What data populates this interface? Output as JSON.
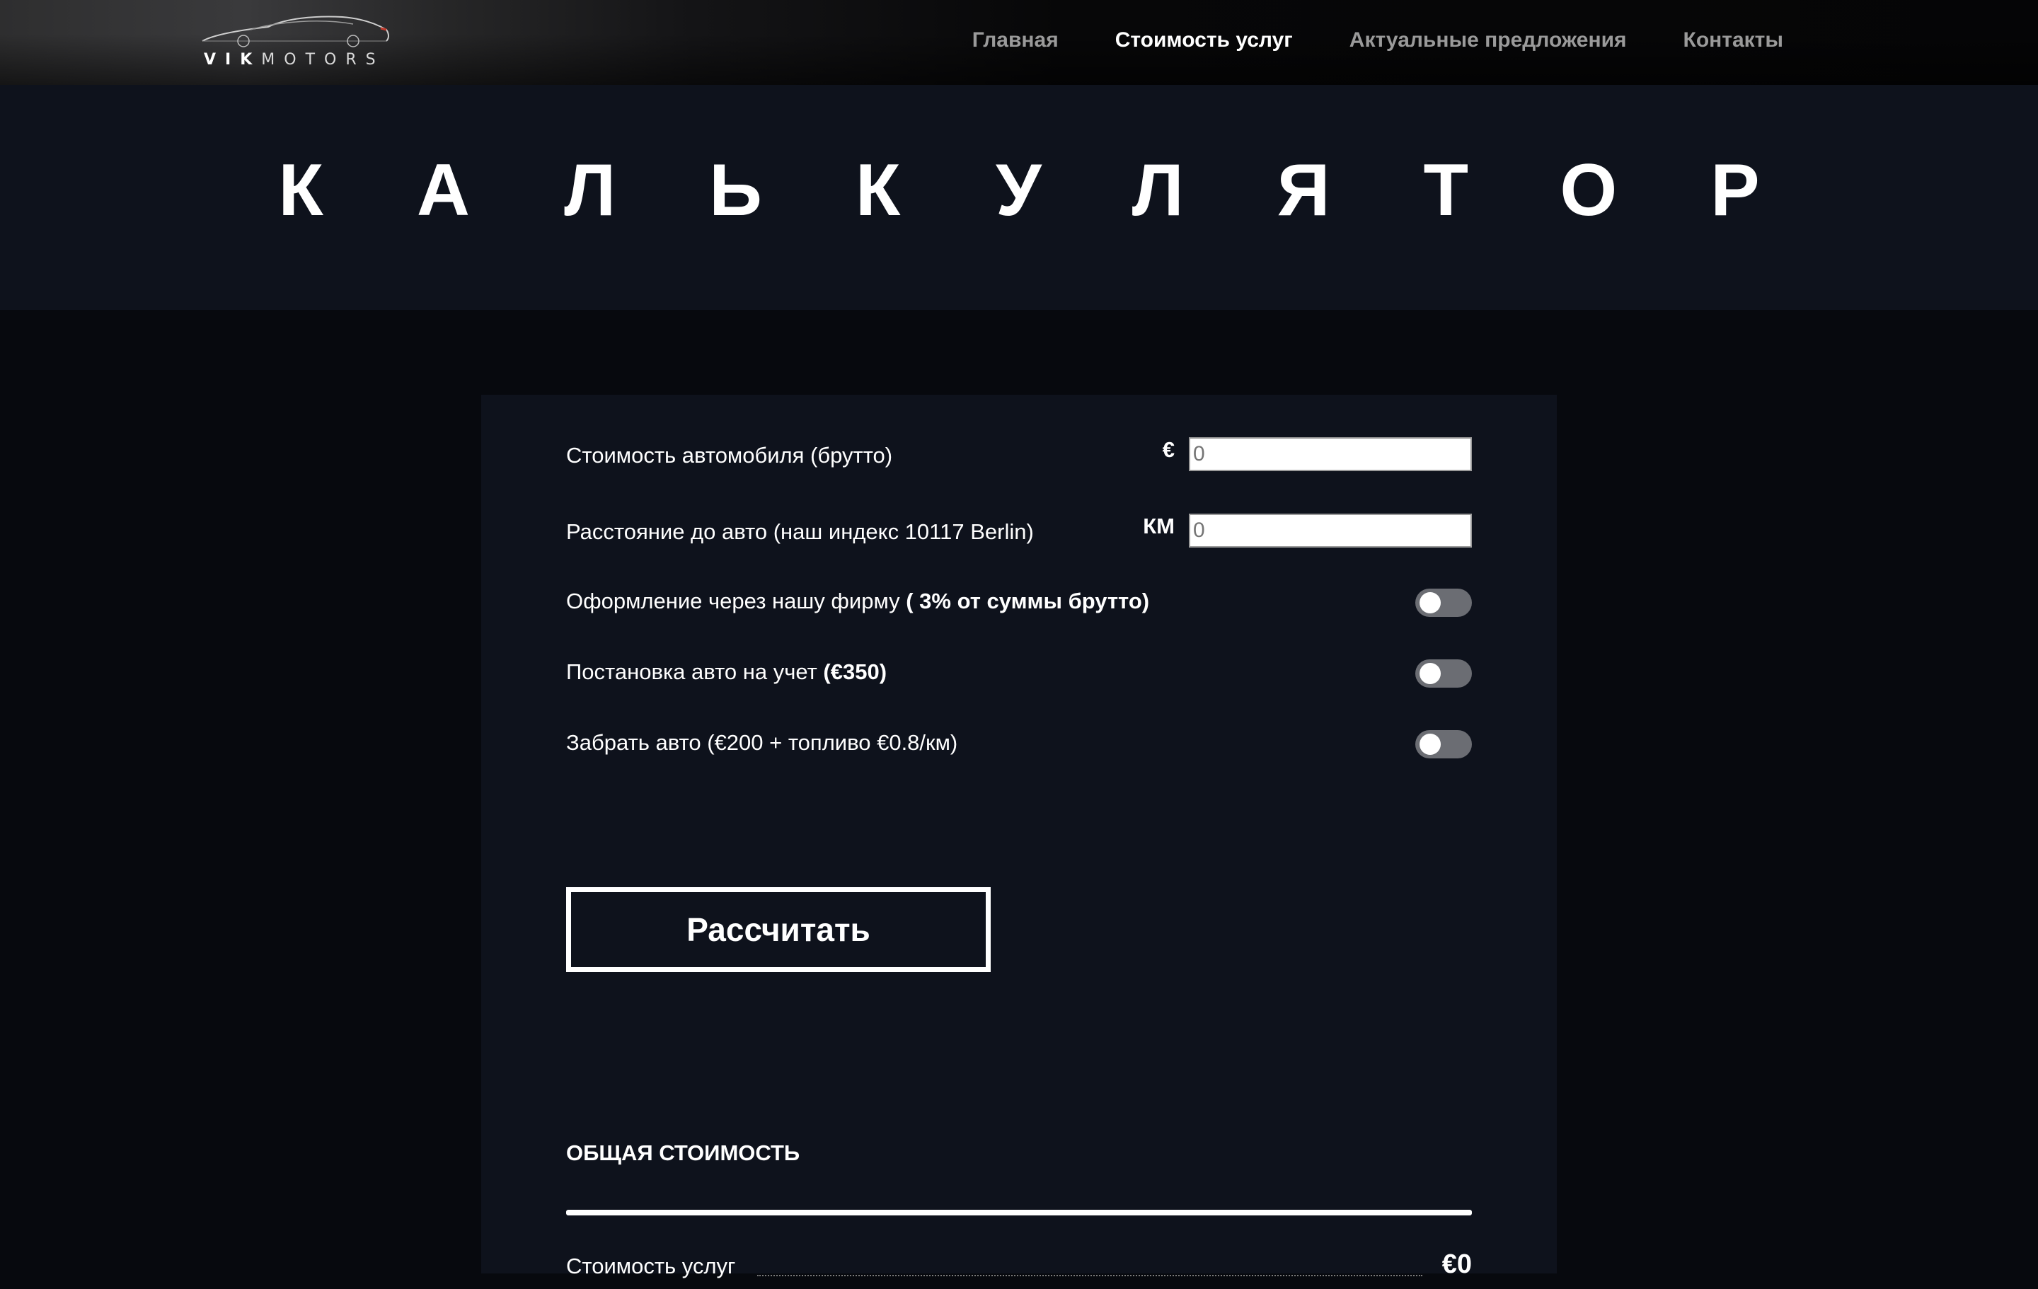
{
  "header": {
    "logo": {
      "brand_bold": "VIK",
      "brand_thin": "MOTORS"
    },
    "nav": [
      {
        "label": "Главная",
        "active": false
      },
      {
        "label": "Стоимость услуг",
        "active": true
      },
      {
        "label": "Актуальные предложения",
        "active": false
      },
      {
        "label": "Контакты",
        "active": false
      }
    ]
  },
  "title": "КАЛЬКУЛЯТОР",
  "calculator": {
    "car_price": {
      "label": "Стоимость автомобиля (брутто)",
      "unit": "€",
      "placeholder": "0"
    },
    "distance": {
      "label": "Расстояние до авто (наш индекс 10117 Berlin)",
      "unit": "КМ",
      "placeholder": "0"
    },
    "registration_firm": {
      "label": "Оформление через нашу фирму ",
      "label_bold": "( 3% от суммы брутто)",
      "enabled": false
    },
    "registration": {
      "label": "Постановка авто на учет ",
      "label_bold": "(€350)",
      "enabled": false
    },
    "pickup": {
      "label": "Забрать авто (€200 + топливо €0.8/км)",
      "enabled": false
    },
    "calculate_button": "Рассчитать"
  },
  "summary": {
    "heading": "ОБЩАЯ СТОИМОСТЬ",
    "services_label": "Стоимость услуг",
    "services_value": "€0"
  },
  "colors": {
    "header_bg": "#050506",
    "band_bg": "#0e121c",
    "page_bg": "#07090e",
    "toggle_off": "#6b6d73",
    "nav_inactive": "#9a9a9a",
    "text": "#ffffff"
  }
}
